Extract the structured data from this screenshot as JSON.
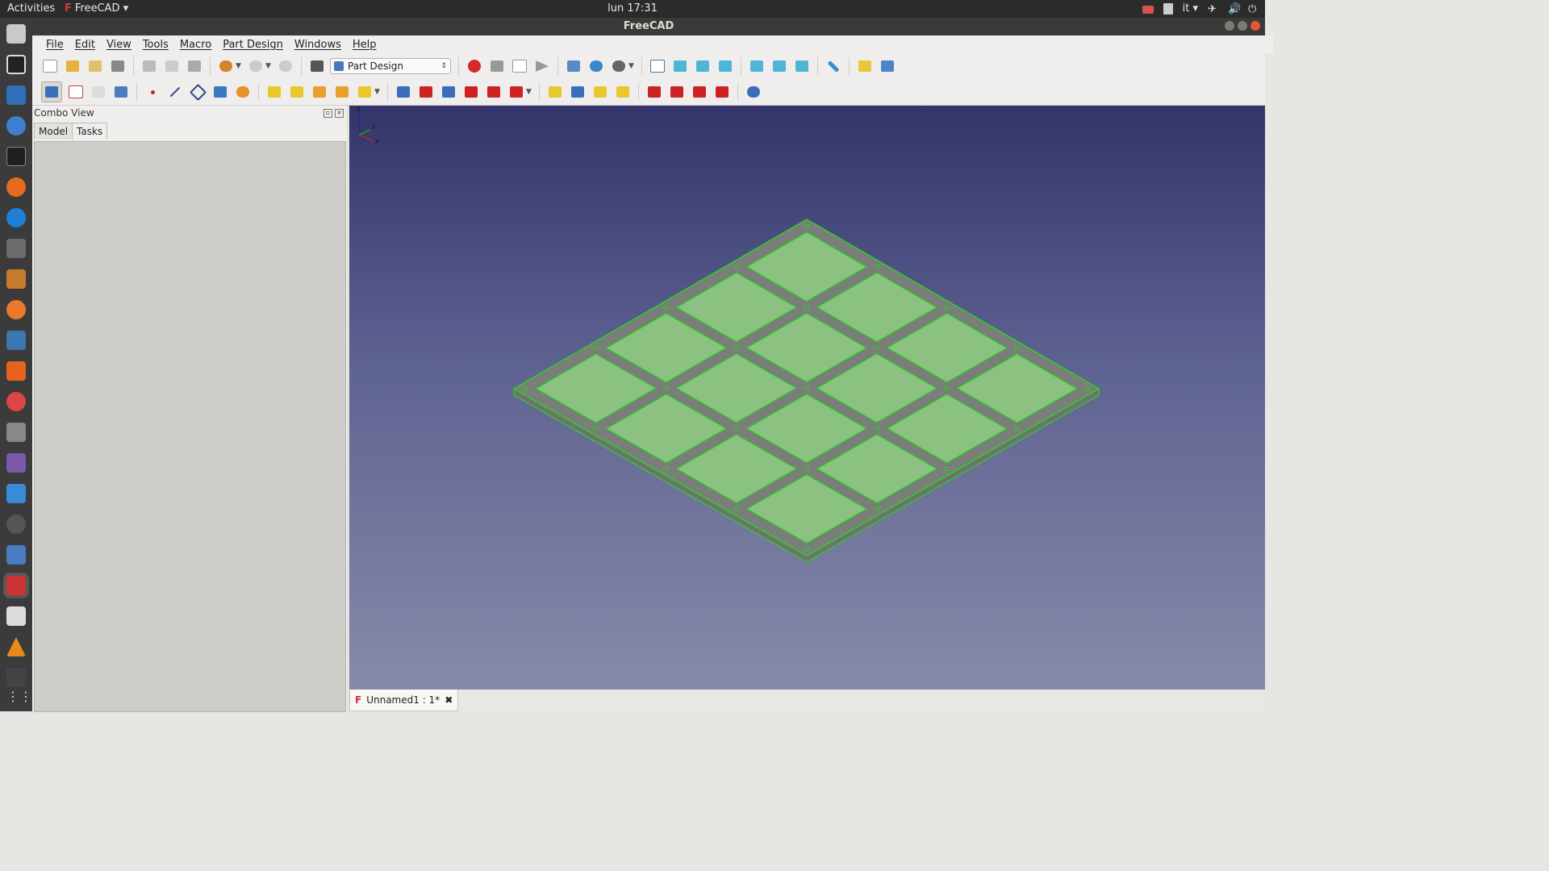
{
  "system_bar": {
    "activities": "Activities",
    "app_name": "FreeCAD",
    "clock": "lun 17:31",
    "keyboard_layout": "it"
  },
  "window": {
    "title": "FreeCAD"
  },
  "menu": {
    "items": [
      "File",
      "Edit",
      "View",
      "Tools",
      "Macro",
      "Part Design",
      "Windows",
      "Help"
    ]
  },
  "toolbar": {
    "workbench_selected": "Part Design",
    "icons_row1": [
      "new-file",
      "open-file",
      "save",
      "print",
      "cut",
      "copy",
      "paste",
      "undo",
      "redo",
      "refresh",
      "whats-this",
      "record-macro",
      "stop-macro",
      "edit-macro",
      "run-macro",
      "fit-all",
      "fit-selection",
      "draw-style",
      "isometric",
      "front",
      "top",
      "right",
      "rear",
      "bottom",
      "left",
      "measure",
      "part",
      "group"
    ],
    "icons_row2": [
      "create-body",
      "create-sketch",
      "validate-sketch",
      "check-geometry",
      "datum-point",
      "datum-line",
      "datum-plane",
      "local-cs",
      "shape-binder",
      "pad",
      "revolution",
      "additive-loft",
      "additive-pipe",
      "additive-primitive",
      "pocket",
      "hole",
      "groove",
      "subtractive-loft",
      "subtractive-pipe",
      "subtractive-primitive",
      "mirrored",
      "linear-pattern",
      "polar-pattern",
      "multi-transform",
      "fillet",
      "chamfer",
      "draft",
      "thickness",
      "boolean"
    ]
  },
  "combo_view": {
    "title": "Combo View",
    "tabs": [
      "Model",
      "Tasks"
    ],
    "active_tab": "Tasks"
  },
  "document_tab": {
    "label": "Unnamed1 : 1*"
  },
  "axis": {
    "x": "X",
    "y": "Y",
    "z": "Z"
  },
  "colors": {
    "face": "#8bc282",
    "edge": "#27d61f",
    "frame": "#7a7d7a",
    "bg_top": "#33346a",
    "bg_bottom": "#878aa8"
  }
}
